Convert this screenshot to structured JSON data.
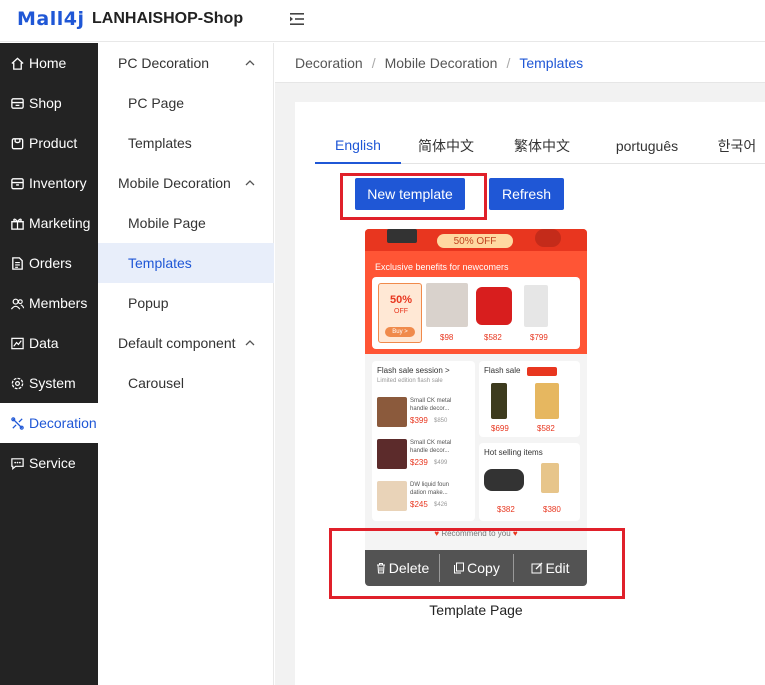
{
  "header": {
    "logo": "Mall4j",
    "shop_name": "LANHAISHOP-Shop",
    "collapse_icon": "menu-fold-icon"
  },
  "sidebar": {
    "items": [
      {
        "label": "Home",
        "icon": "home-icon"
      },
      {
        "label": "Shop",
        "icon": "shop-icon"
      },
      {
        "label": "Product",
        "icon": "product-icon"
      },
      {
        "label": "Inventory",
        "icon": "inventory-icon"
      },
      {
        "label": "Marketing",
        "icon": "gift-icon"
      },
      {
        "label": "Orders",
        "icon": "orders-icon"
      },
      {
        "label": "Members",
        "icon": "members-icon"
      },
      {
        "label": "Data",
        "icon": "data-icon"
      },
      {
        "label": "System",
        "icon": "gear-icon"
      },
      {
        "label": "Decoration",
        "icon": "decoration-icon",
        "active": true
      },
      {
        "label": "Service",
        "icon": "chat-icon"
      }
    ]
  },
  "subnav": {
    "groups": [
      {
        "label": "PC Decoration",
        "items": [
          "PC Page",
          "Templates"
        ]
      },
      {
        "label": "Mobile Decoration",
        "items": [
          "Mobile Page",
          "Templates",
          "Popup"
        ]
      },
      {
        "label": "Default component",
        "items": [
          "Carousel"
        ]
      }
    ],
    "active_item": "Templates"
  },
  "breadcrumb": [
    "Decoration",
    "Mobile Decoration",
    "Templates"
  ],
  "tabs": [
    "English",
    "简体中文",
    "繁体中文",
    "português",
    "한국어"
  ],
  "buttons": {
    "new_template": "New template",
    "refresh": "Refresh"
  },
  "template": {
    "preview": {
      "off_badge": "50% OFF",
      "exclusive": "Exclusive benefits for newcomers",
      "fifty": "50%",
      "off": "OFF",
      "buy": "Buy >",
      "prices": [
        "$98",
        "$582",
        "$799"
      ],
      "flash_session": "Flash sale session >",
      "limited": "Limited edition flash sale",
      "flash_items": [
        {
          "name": "Small CK metal",
          "name2": "handle decor...",
          "price": "$399",
          "orig": "$850"
        },
        {
          "name": "Small CK metal",
          "name2": "handle decor...",
          "price": "$239",
          "orig": "$499"
        },
        {
          "name": "DW liquid foun",
          "name2": "dation make...",
          "price": "$245",
          "orig": "$426"
        }
      ],
      "flash_sale": "Flash sale",
      "flash_sale_prices": [
        "$699",
        "$582"
      ],
      "hot_selling": "Hot selling items",
      "hot_prices": [
        "$382",
        "$380"
      ],
      "recommend": "Recommend to you"
    },
    "actions": {
      "delete": "Delete",
      "copy": "Copy",
      "edit": "Edit"
    },
    "caption": "Template Page"
  },
  "colors": {
    "accent": "#1f57d6",
    "sidebar_bg": "#232323",
    "highlight_border": "#e0202a",
    "banner": "#ff5535"
  }
}
